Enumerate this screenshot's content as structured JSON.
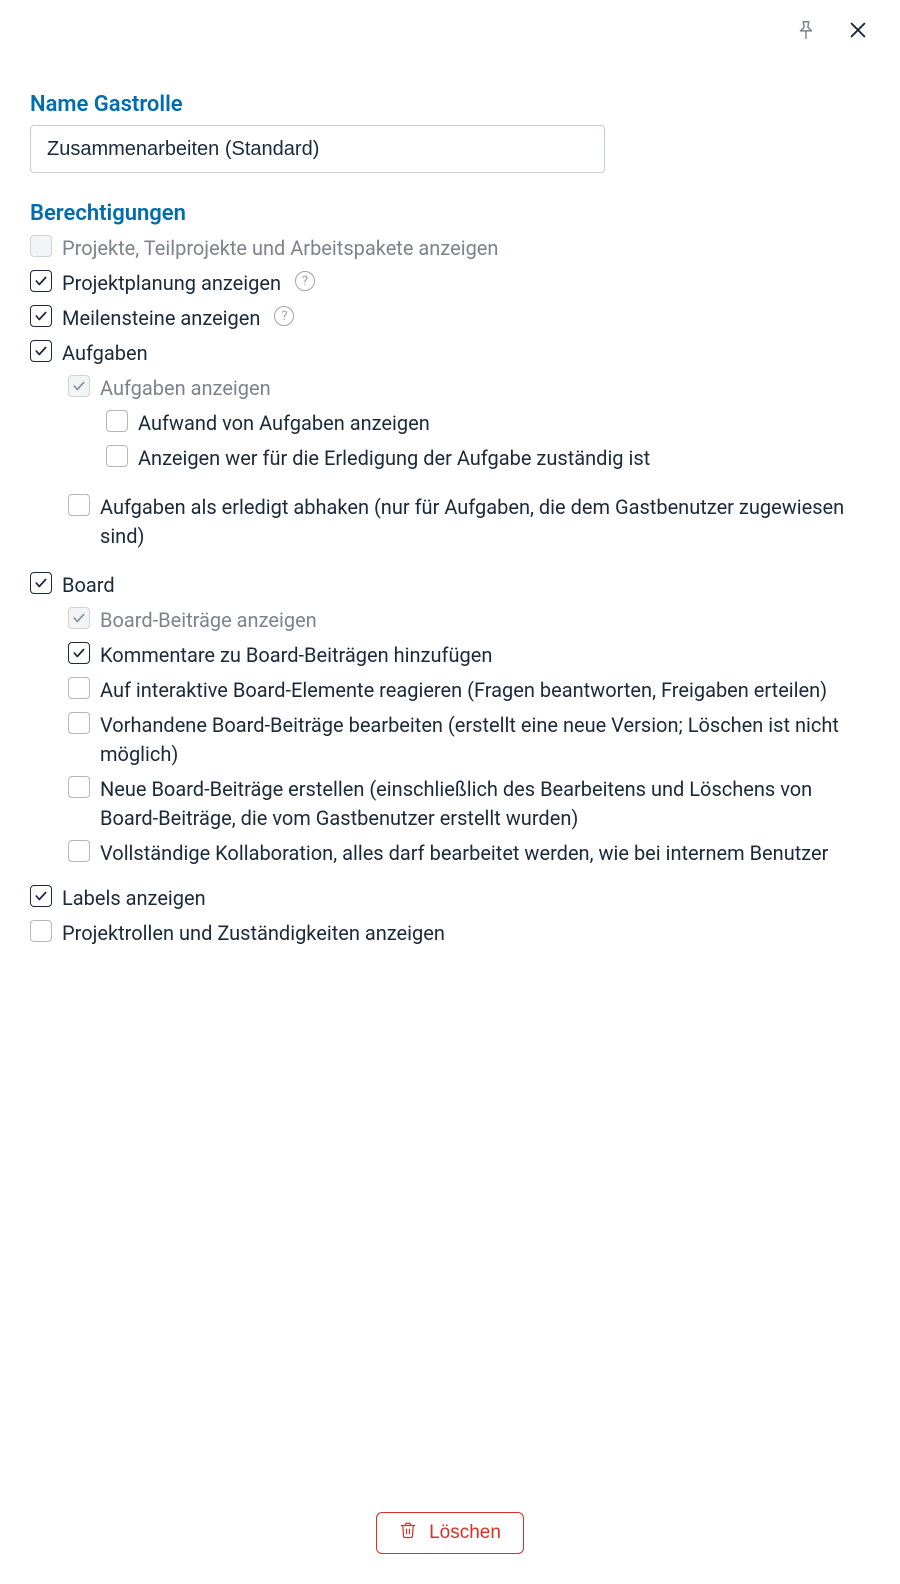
{
  "header": {
    "name_label": "Name Gastrolle",
    "name_value": "Zusammenarbeiten (Standard)"
  },
  "perm_header": "Berechtigungen",
  "perms": {
    "view_projects": "Projekte, Teilprojekte und Arbeitspakete anzeigen",
    "view_planning": "Projektplanung anzeigen",
    "view_milestones": "Meilensteine anzeigen",
    "tasks": "Aufgaben",
    "tasks_view": "Aufgaben anzeigen",
    "tasks_effort": "Aufwand von Aufgaben anzeigen",
    "tasks_responsible": "Anzeigen wer für die Erledigung der Aufgabe zuständig ist",
    "tasks_checkoff": "Aufgaben als erledigt abhaken (nur für Aufgaben, die dem Gastbenutzer zugewiesen sind)",
    "board": "Board",
    "board_view": "Board-Beiträge anzeigen",
    "board_comment": "Kommentare zu Board-Beiträgen hinzufügen",
    "board_react": "Auf interaktive Board-Elemente reagieren (Fragen beantworten, Freigaben erteilen)",
    "board_edit": "Vorhandene Board-Beiträge bearbeiten (erstellt eine neue Version; Löschen ist nicht möglich)",
    "board_create": "Neue Board-Beiträge erstellen (einschließlich des Bearbeitens und Löschens von Board-Beiträge, die vom Gastbenutzer erstellt wurden)",
    "board_full": "Vollständige Kollaboration, alles darf bearbeitet werden, wie bei internem Benutzer",
    "labels": "Labels anzeigen",
    "roles": "Projektrollen und Zuständigkeiten anzeigen"
  },
  "footer": {
    "delete": "Löschen"
  }
}
